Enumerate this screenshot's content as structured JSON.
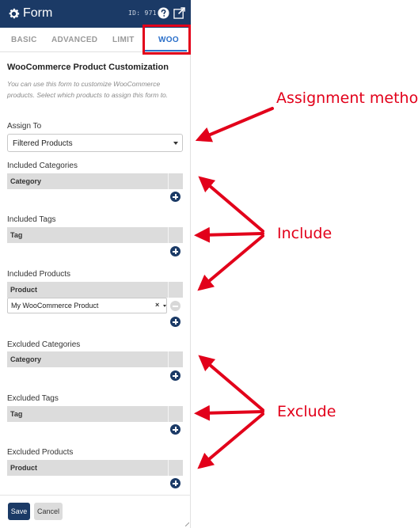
{
  "header": {
    "title": "Form",
    "id_label": "ID: 971"
  },
  "tabs": [
    {
      "label": "BASIC"
    },
    {
      "label": "ADVANCED"
    },
    {
      "label": "LIMIT"
    },
    {
      "label": "WOO"
    }
  ],
  "section": {
    "title": "WooCommerce Product Customization",
    "description": "You can use this form to customize WooCommerce products. Select which products to assign this form to."
  },
  "assign": {
    "label": "Assign To",
    "value": "Filtered Products"
  },
  "included_categories": {
    "label": "Included Categories",
    "column": "Category"
  },
  "included_tags": {
    "label": "Included Tags",
    "column": "Tag"
  },
  "included_products": {
    "label": "Included Products",
    "column": "Product",
    "rows": [
      "My WooCommerce Product"
    ]
  },
  "excluded_categories": {
    "label": "Excluded Categories",
    "column": "Category"
  },
  "excluded_tags": {
    "label": "Excluded Tags",
    "column": "Tag"
  },
  "excluded_products": {
    "label": "Excluded Products",
    "column": "Product"
  },
  "footer": {
    "save_label": "Save",
    "cancel_label": "Cancel"
  },
  "annotations": {
    "assignment": "Assignment method",
    "include": "Include",
    "exclude": "Exclude"
  },
  "colors": {
    "header_bg": "#1b3a66",
    "active_tab": "#2a6fc9",
    "annotation_red": "#e2001a"
  },
  "icons": [
    "gear-icon",
    "help-icon",
    "expand-icon",
    "add-icon",
    "remove-icon",
    "chevron-down-icon",
    "clear-icon"
  ]
}
